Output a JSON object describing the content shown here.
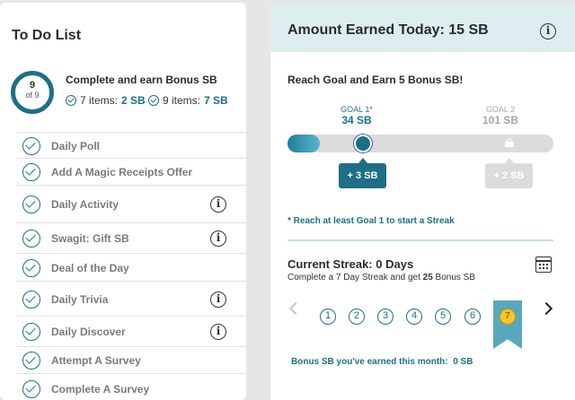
{
  "todo": {
    "title": "To Do List",
    "progress_count": "9",
    "progress_total": "of 9",
    "complete_title": "Complete and earn Bonus SB",
    "tier1_text": "7 items:",
    "tier1_value": "2 SB",
    "tier2_text": "9 items:",
    "tier2_value": "7 SB",
    "tasks": [
      {
        "label": "Daily Poll",
        "info": false
      },
      {
        "label": "Add A Magic Receipts Offer",
        "info": false
      },
      {
        "label": "Daily Activity",
        "info": true
      },
      {
        "label": "Swagit: Gift SB",
        "info": true
      },
      {
        "label": "Deal of the Day",
        "info": false
      },
      {
        "label": "Daily Trivia",
        "info": true
      },
      {
        "label": "Daily Discover",
        "info": true
      },
      {
        "label": "Attempt A Survey",
        "info": false
      },
      {
        "label": "Complete A Survey",
        "info": false
      }
    ],
    "info_glyph": "i"
  },
  "earned": {
    "title": "Amount Earned Today: 15 SB",
    "info_glyph": "i",
    "goal_heading": "Reach Goal and Earn 5 Bonus SB!",
    "goal1_label": "GOAL 1*",
    "goal1_value": "34 SB",
    "goal2_label": "GOAL 2",
    "goal2_value": "101 SB",
    "progress_fraction": 0.12,
    "bonus1": "+ 3 SB",
    "bonus2": "+ 2 SB",
    "note": "* Reach at least Goal 1 to start a Streak"
  },
  "streak": {
    "title": "Current Streak: 0 Days",
    "subtitle_pre": "Complete a 7 Day Streak and get ",
    "subtitle_bold": "25",
    "subtitle_post": " Bonus SB",
    "days": [
      "1",
      "2",
      "3",
      "4",
      "5",
      "6"
    ],
    "day7": "7",
    "month_label": "Bonus SB you've earned this month:",
    "month_value": "0 SB"
  },
  "colors": {
    "accent": "#1e6f86",
    "header_bg": "#deedf0",
    "reward_gold": "#f3c629"
  },
  "icons": {
    "check": "check-circle-icon",
    "info": "info-icon",
    "calendar": "calendar-icon",
    "lock": "lock-icon",
    "prev": "chevron-left-icon",
    "next": "chevron-right-icon",
    "ribbon": "ribbon-icon"
  }
}
